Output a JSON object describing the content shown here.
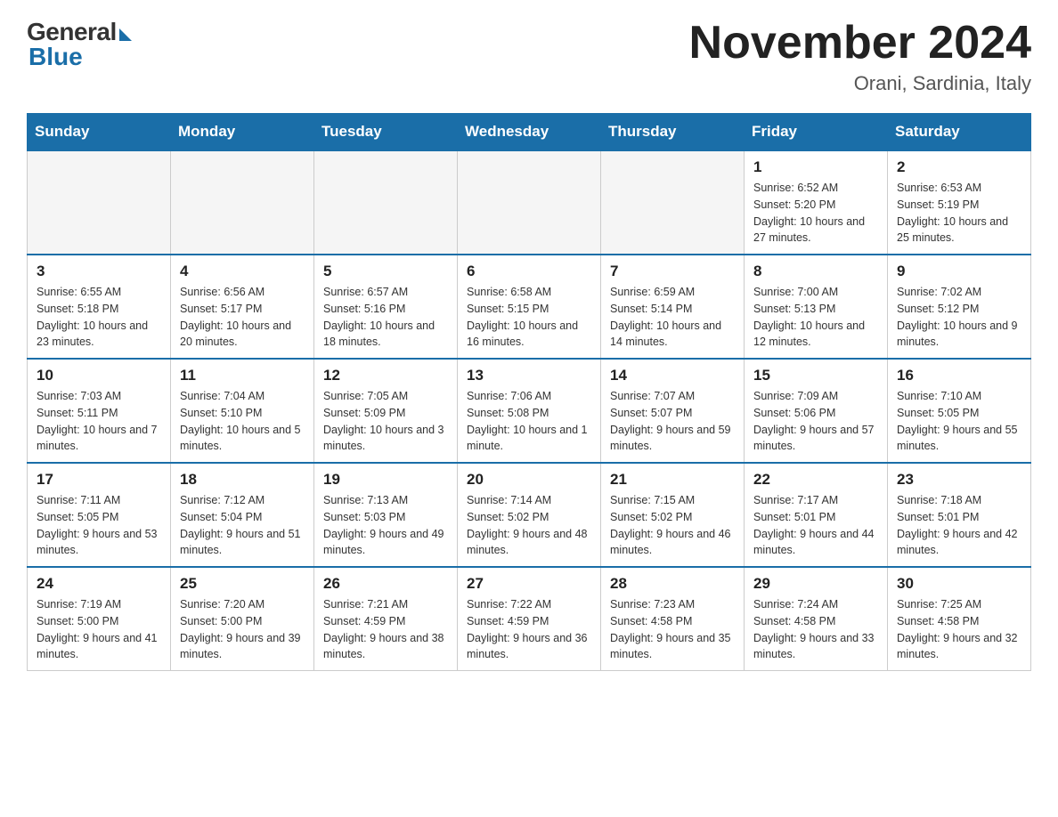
{
  "header": {
    "logo": {
      "general_text": "General",
      "blue_text": "Blue"
    },
    "title": "November 2024",
    "subtitle": "Orani, Sardinia, Italy"
  },
  "days_of_week": [
    "Sunday",
    "Monday",
    "Tuesday",
    "Wednesday",
    "Thursday",
    "Friday",
    "Saturday"
  ],
  "weeks": [
    {
      "days": [
        {
          "number": "",
          "empty": true
        },
        {
          "number": "",
          "empty": true
        },
        {
          "number": "",
          "empty": true
        },
        {
          "number": "",
          "empty": true
        },
        {
          "number": "",
          "empty": true
        },
        {
          "number": "1",
          "sunrise": "Sunrise: 6:52 AM",
          "sunset": "Sunset: 5:20 PM",
          "daylight": "Daylight: 10 hours and 27 minutes."
        },
        {
          "number": "2",
          "sunrise": "Sunrise: 6:53 AM",
          "sunset": "Sunset: 5:19 PM",
          "daylight": "Daylight: 10 hours and 25 minutes."
        }
      ]
    },
    {
      "days": [
        {
          "number": "3",
          "sunrise": "Sunrise: 6:55 AM",
          "sunset": "Sunset: 5:18 PM",
          "daylight": "Daylight: 10 hours and 23 minutes."
        },
        {
          "number": "4",
          "sunrise": "Sunrise: 6:56 AM",
          "sunset": "Sunset: 5:17 PM",
          "daylight": "Daylight: 10 hours and 20 minutes."
        },
        {
          "number": "5",
          "sunrise": "Sunrise: 6:57 AM",
          "sunset": "Sunset: 5:16 PM",
          "daylight": "Daylight: 10 hours and 18 minutes."
        },
        {
          "number": "6",
          "sunrise": "Sunrise: 6:58 AM",
          "sunset": "Sunset: 5:15 PM",
          "daylight": "Daylight: 10 hours and 16 minutes."
        },
        {
          "number": "7",
          "sunrise": "Sunrise: 6:59 AM",
          "sunset": "Sunset: 5:14 PM",
          "daylight": "Daylight: 10 hours and 14 minutes."
        },
        {
          "number": "8",
          "sunrise": "Sunrise: 7:00 AM",
          "sunset": "Sunset: 5:13 PM",
          "daylight": "Daylight: 10 hours and 12 minutes."
        },
        {
          "number": "9",
          "sunrise": "Sunrise: 7:02 AM",
          "sunset": "Sunset: 5:12 PM",
          "daylight": "Daylight: 10 hours and 9 minutes."
        }
      ]
    },
    {
      "days": [
        {
          "number": "10",
          "sunrise": "Sunrise: 7:03 AM",
          "sunset": "Sunset: 5:11 PM",
          "daylight": "Daylight: 10 hours and 7 minutes."
        },
        {
          "number": "11",
          "sunrise": "Sunrise: 7:04 AM",
          "sunset": "Sunset: 5:10 PM",
          "daylight": "Daylight: 10 hours and 5 minutes."
        },
        {
          "number": "12",
          "sunrise": "Sunrise: 7:05 AM",
          "sunset": "Sunset: 5:09 PM",
          "daylight": "Daylight: 10 hours and 3 minutes."
        },
        {
          "number": "13",
          "sunrise": "Sunrise: 7:06 AM",
          "sunset": "Sunset: 5:08 PM",
          "daylight": "Daylight: 10 hours and 1 minute."
        },
        {
          "number": "14",
          "sunrise": "Sunrise: 7:07 AM",
          "sunset": "Sunset: 5:07 PM",
          "daylight": "Daylight: 9 hours and 59 minutes."
        },
        {
          "number": "15",
          "sunrise": "Sunrise: 7:09 AM",
          "sunset": "Sunset: 5:06 PM",
          "daylight": "Daylight: 9 hours and 57 minutes."
        },
        {
          "number": "16",
          "sunrise": "Sunrise: 7:10 AM",
          "sunset": "Sunset: 5:05 PM",
          "daylight": "Daylight: 9 hours and 55 minutes."
        }
      ]
    },
    {
      "days": [
        {
          "number": "17",
          "sunrise": "Sunrise: 7:11 AM",
          "sunset": "Sunset: 5:05 PM",
          "daylight": "Daylight: 9 hours and 53 minutes."
        },
        {
          "number": "18",
          "sunrise": "Sunrise: 7:12 AM",
          "sunset": "Sunset: 5:04 PM",
          "daylight": "Daylight: 9 hours and 51 minutes."
        },
        {
          "number": "19",
          "sunrise": "Sunrise: 7:13 AM",
          "sunset": "Sunset: 5:03 PM",
          "daylight": "Daylight: 9 hours and 49 minutes."
        },
        {
          "number": "20",
          "sunrise": "Sunrise: 7:14 AM",
          "sunset": "Sunset: 5:02 PM",
          "daylight": "Daylight: 9 hours and 48 minutes."
        },
        {
          "number": "21",
          "sunrise": "Sunrise: 7:15 AM",
          "sunset": "Sunset: 5:02 PM",
          "daylight": "Daylight: 9 hours and 46 minutes."
        },
        {
          "number": "22",
          "sunrise": "Sunrise: 7:17 AM",
          "sunset": "Sunset: 5:01 PM",
          "daylight": "Daylight: 9 hours and 44 minutes."
        },
        {
          "number": "23",
          "sunrise": "Sunrise: 7:18 AM",
          "sunset": "Sunset: 5:01 PM",
          "daylight": "Daylight: 9 hours and 42 minutes."
        }
      ]
    },
    {
      "days": [
        {
          "number": "24",
          "sunrise": "Sunrise: 7:19 AM",
          "sunset": "Sunset: 5:00 PM",
          "daylight": "Daylight: 9 hours and 41 minutes."
        },
        {
          "number": "25",
          "sunrise": "Sunrise: 7:20 AM",
          "sunset": "Sunset: 5:00 PM",
          "daylight": "Daylight: 9 hours and 39 minutes."
        },
        {
          "number": "26",
          "sunrise": "Sunrise: 7:21 AM",
          "sunset": "Sunset: 4:59 PM",
          "daylight": "Daylight: 9 hours and 38 minutes."
        },
        {
          "number": "27",
          "sunrise": "Sunrise: 7:22 AM",
          "sunset": "Sunset: 4:59 PM",
          "daylight": "Daylight: 9 hours and 36 minutes."
        },
        {
          "number": "28",
          "sunrise": "Sunrise: 7:23 AM",
          "sunset": "Sunset: 4:58 PM",
          "daylight": "Daylight: 9 hours and 35 minutes."
        },
        {
          "number": "29",
          "sunrise": "Sunrise: 7:24 AM",
          "sunset": "Sunset: 4:58 PM",
          "daylight": "Daylight: 9 hours and 33 minutes."
        },
        {
          "number": "30",
          "sunrise": "Sunrise: 7:25 AM",
          "sunset": "Sunset: 4:58 PM",
          "daylight": "Daylight: 9 hours and 32 minutes."
        }
      ]
    }
  ]
}
